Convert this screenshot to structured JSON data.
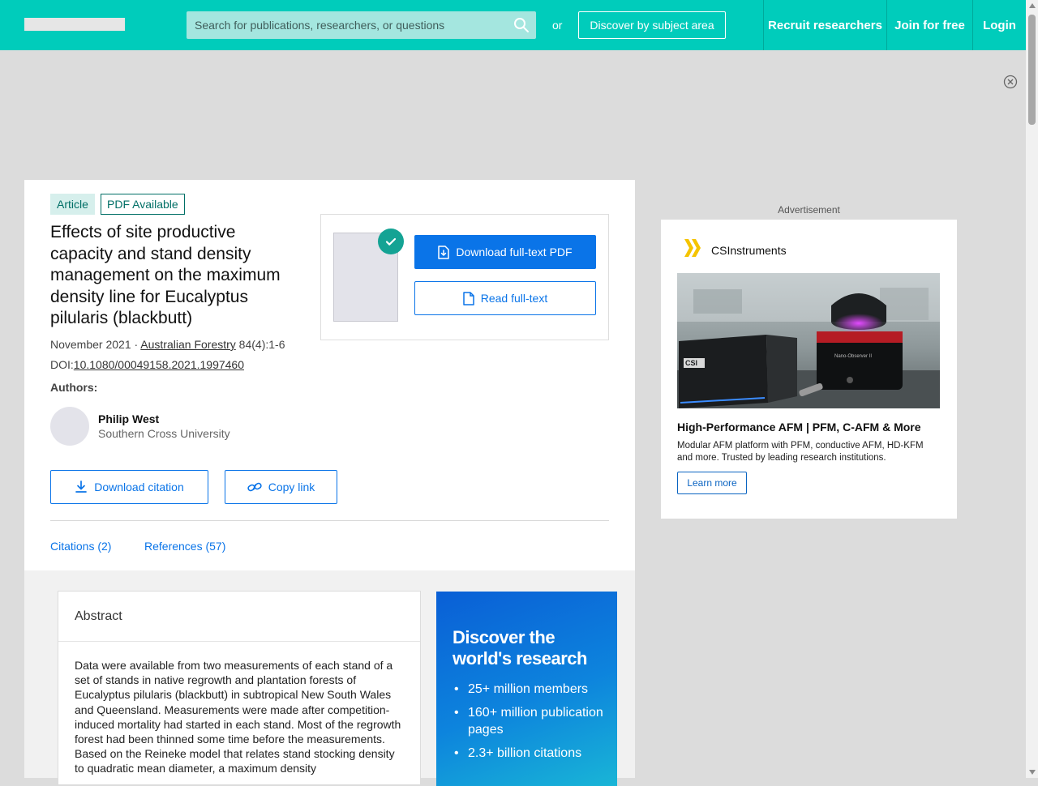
{
  "header": {
    "search_placeholder": "Search for publications, researchers, or questions",
    "or_text": "or",
    "discover_label": "Discover by subject area",
    "nav": [
      "Recruit researchers",
      "Join for free",
      "Login"
    ]
  },
  "article": {
    "badges": [
      "Article",
      "PDF Available"
    ],
    "title": "Effects of site productive capacity and stand density management on the maximum density line for Eucalyptus pilularis (blackbutt)",
    "date": "November 2021",
    "meta_sep": " · ",
    "journal": "Australian Forestry",
    "volume": " 84(4):1-6",
    "doi_label": "DOI:",
    "doi": "10.1080/00049158.2021.1997460",
    "authors_label": "Authors:",
    "author_name": "Philip West",
    "author_affiliation": "Southern Cross University",
    "download_citation": "Download citation",
    "copy_link": "Copy link",
    "tabs": [
      "Citations (2)",
      "References (57)"
    ]
  },
  "pdf_box": {
    "download_label": "Download full-text PDF",
    "read_label": "Read full-text"
  },
  "abstract": {
    "heading": "Abstract",
    "text": "Data were available from two measurements of each stand of a set of stands in native regrowth and plantation forests of Eucalyptus pilularis (blackbutt) in subtropical New South Wales and Queensland. Measurements were made after competition-induced mortality had started in each stand. Most of the regrowth forest had been thinned some time before the measurements. Based on the Reineke model that relates stand stocking density to quadratic mean diameter, a maximum density"
  },
  "promo": {
    "title": "Discover the world's research",
    "items": [
      "25+ million members",
      "160+ million publication pages",
      "2.3+ billion citations"
    ]
  },
  "ad": {
    "label": "Advertisement",
    "brand": "CSInstruments",
    "headline": "High-Performance AFM | PFM, C-AFM & More",
    "text": "Modular AFM platform with PFM, conductive AFM, HD-KFM and more. Trusted by leading research institutions.",
    "cta": "Learn more",
    "device_label": "CSI",
    "device_sublabel": "Nano-Observer II"
  },
  "colors": {
    "header_bg": "#00ccbb",
    "accent_blue": "#0a74e8",
    "badge_green": "#006f66",
    "check_green": "#14a394"
  }
}
